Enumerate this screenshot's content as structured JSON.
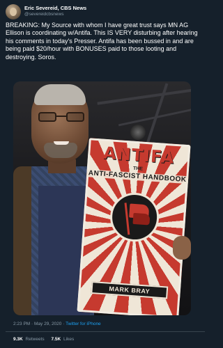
{
  "author": {
    "display_name": "Eric Severeid, CBS News",
    "handle": "@severeidcbsnews"
  },
  "tweet": {
    "text": "BREAKING: My Source with whom I have great trust says MN AG Ellison is coordinating w/Antifa. This IS VERY disturbing after hearing his comments in today's Presser. Antifa has been bussed in and are being paid $20/hour with BONUSES paid to those looting and destroying. Soros.",
    "time": "2:23 PM",
    "date": "May 29, 2020",
    "separator": "·",
    "source": "Twitter for iPhone"
  },
  "media": {
    "book": {
      "title": "ANTIFA",
      "the": "THE",
      "subtitle": "ANTI-FASCIST HANDBOOK",
      "author": "MARK BRAY"
    }
  },
  "stats": {
    "retweets_count": "9.3K",
    "retweets_label": "Retweets",
    "likes_count": "7.5K",
    "likes_label": "Likes"
  },
  "colors": {
    "background": "#15202b",
    "muted": "#8899a6",
    "link": "#1da1f2",
    "book_red": "#c63a2f"
  }
}
